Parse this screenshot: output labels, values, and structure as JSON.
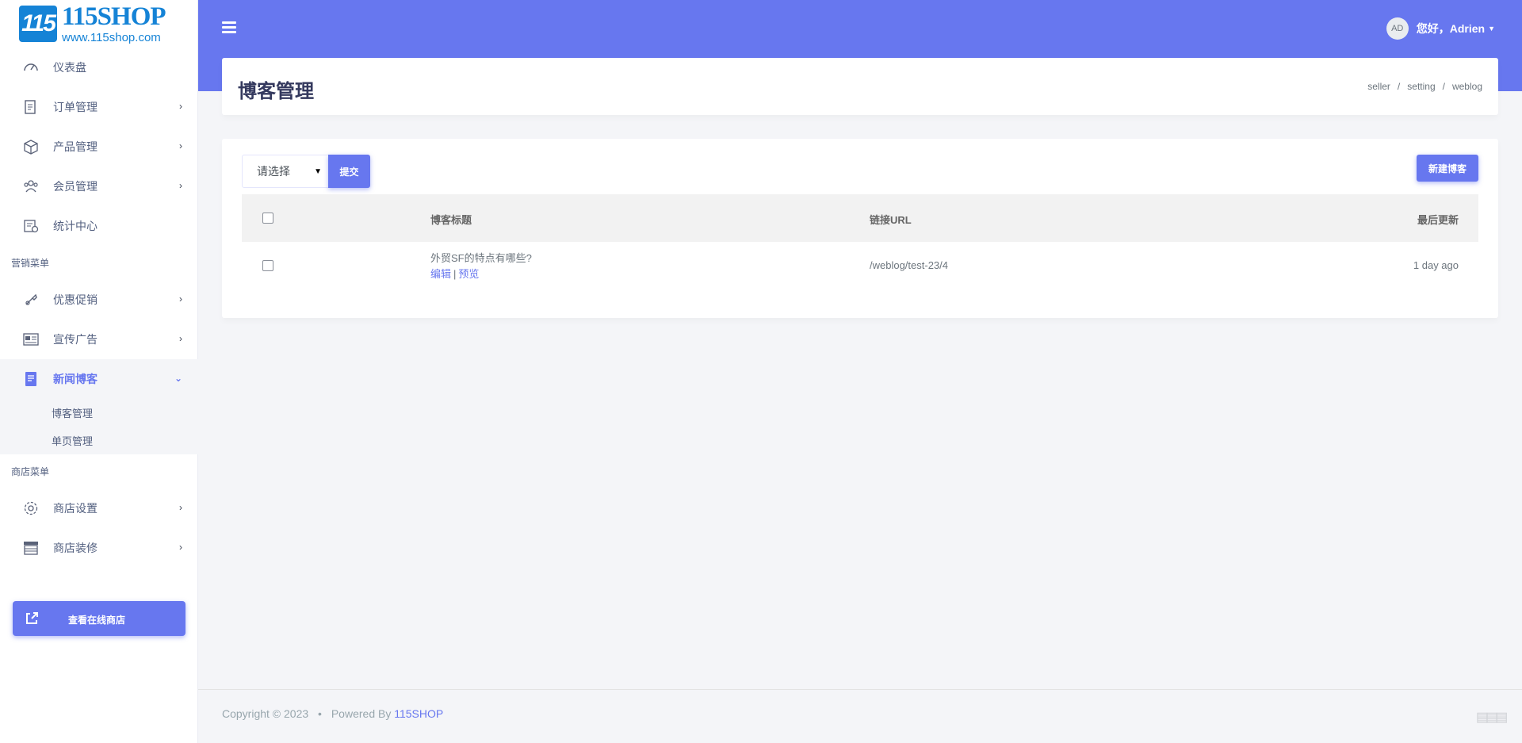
{
  "brand": {
    "logo_mark": "115",
    "name": "115SHOP",
    "url": "www.115shop.com"
  },
  "sidebar": {
    "items": [
      {
        "label": "仪表盘",
        "icon": "dashboard-icon"
      },
      {
        "label": "订单管理",
        "icon": "order-icon"
      },
      {
        "label": "产品管理",
        "icon": "product-icon"
      },
      {
        "label": "会员管理",
        "icon": "members-icon"
      },
      {
        "label": "统计中心",
        "icon": "stats-icon"
      }
    ],
    "section_marketing": "营销菜单",
    "marketing_items": [
      {
        "label": "优惠促销",
        "icon": "promotion-icon"
      },
      {
        "label": "宣传广告",
        "icon": "ads-icon"
      },
      {
        "label": "新闻博客",
        "icon": "news-icon"
      }
    ],
    "news_sub": [
      "博客管理",
      "单页管理"
    ],
    "section_shop": "商店菜单",
    "shop_items": [
      {
        "label": "商店设置",
        "icon": "settings-icon"
      },
      {
        "label": "商店装修",
        "icon": "decor-icon"
      }
    ],
    "view_store_label": "查看在线商店"
  },
  "header": {
    "avatar_initials": "AD",
    "greeting": "您好，",
    "username": "Adrien"
  },
  "page": {
    "title": "博客管理",
    "breadcrumb": [
      "seller",
      "setting",
      "weblog"
    ]
  },
  "toolbar": {
    "select_value": "请选择",
    "submit_label": "提交",
    "new_label": "新建博客"
  },
  "table": {
    "headers": {
      "title": "博客标题",
      "url": "链接URL",
      "updated": "最后更新"
    },
    "rows": [
      {
        "title": "外贸SF的特点有哪些?",
        "edit": "编辑",
        "preview": "预览",
        "url": "/weblog/test-23/4",
        "updated": "1 day ago"
      }
    ]
  },
  "footer": {
    "copyright": "Copyright © 2023",
    "powered_by": "Powered By",
    "brand_link": "115SHOP"
  },
  "colors": {
    "accent": "#6777ef",
    "sidebar_bg": "#ffffff",
    "page_bg": "#f4f5f8"
  }
}
